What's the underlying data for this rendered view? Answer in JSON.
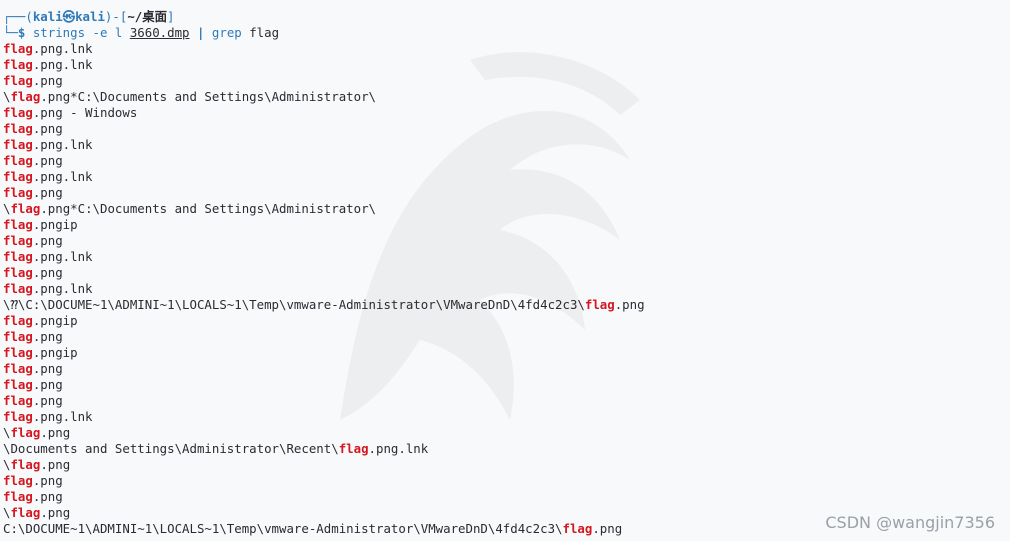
{
  "prompt": {
    "top_left": "┌──(",
    "user": "kali㉿kali",
    "mid": ")-[",
    "dir": "~/桌面",
    "close": "]",
    "bottom_left": "└─",
    "dollar": "$ ",
    "command_name": "strings",
    "command_args": " -e l ",
    "command_file": "3660.dmp",
    "pipe": " | ",
    "grep_cmd": "grep",
    "grep_arg": " flag"
  },
  "output_lines": [
    {
      "pre": "",
      "hl": "flag",
      "post": ".png.lnk"
    },
    {
      "pre": "",
      "hl": "flag",
      "post": ".png.lnk"
    },
    {
      "pre": "",
      "hl": "flag",
      "post": ".png"
    },
    {
      "pre": "\\",
      "hl": "flag",
      "post": ".png*C:\\Documents and Settings\\Administrator\\"
    },
    {
      "pre": "",
      "hl": "flag",
      "post": ".png - Windows"
    },
    {
      "pre": "",
      "hl": "flag",
      "post": ".png"
    },
    {
      "pre": "",
      "hl": "flag",
      "post": ".png.lnk"
    },
    {
      "pre": "",
      "hl": "flag",
      "post": ".png"
    },
    {
      "pre": "",
      "hl": "flag",
      "post": ".png.lnk"
    },
    {
      "pre": "",
      "hl": "flag",
      "post": ".png"
    },
    {
      "pre": "\\",
      "hl": "flag",
      "post": ".png*C:\\Documents and Settings\\Administrator\\"
    },
    {
      "pre": "",
      "hl": "flag",
      "post": ".pngip"
    },
    {
      "pre": "",
      "hl": "flag",
      "post": ".png"
    },
    {
      "pre": "",
      "hl": "flag",
      "post": ".png.lnk"
    },
    {
      "pre": "",
      "hl": "flag",
      "post": ".png"
    },
    {
      "pre": "",
      "hl": "flag",
      "post": ".png.lnk"
    },
    {
      "pre": "\\⁇\\C:\\DOCUME~1\\ADMINI~1\\LOCALS~1\\Temp\\vmware-Administrator\\VMwareDnD\\4fd4c2c3\\",
      "hl": "flag",
      "post": ".png"
    },
    {
      "pre": "",
      "hl": "flag",
      "post": ".pngip"
    },
    {
      "pre": "",
      "hl": "flag",
      "post": ".png"
    },
    {
      "pre": "",
      "hl": "flag",
      "post": ".pngip"
    },
    {
      "pre": "",
      "hl": "flag",
      "post": ".png"
    },
    {
      "pre": "",
      "hl": "flag",
      "post": ".png"
    },
    {
      "pre": "",
      "hl": "flag",
      "post": ".png"
    },
    {
      "pre": "",
      "hl": "flag",
      "post": ".png.lnk"
    },
    {
      "pre": "\\",
      "hl": "flag",
      "post": ".png"
    },
    {
      "pre": "\\Documents and Settings\\Administrator\\Recent\\",
      "hl": "flag",
      "post": ".png.lnk"
    },
    {
      "pre": "\\",
      "hl": "flag",
      "post": ".png"
    },
    {
      "pre": "",
      "hl": "flag",
      "post": ".png"
    },
    {
      "pre": "",
      "hl": "flag",
      "post": ".png"
    },
    {
      "pre": "\\",
      "hl": "flag",
      "post": ".png"
    },
    {
      "pre": "C:\\DOCUME~1\\ADMINI~1\\LOCALS~1\\Temp\\vmware-Administrator\\VMwareDnD\\4fd4c2c3\\",
      "hl": "flag",
      "post": ".png"
    }
  ],
  "watermark": "CSDN @wangjin7356",
  "colors": {
    "background": "#f8f9fb",
    "highlight": "#d4161e",
    "prompt": "#2e7ab8",
    "text": "#2b2b33"
  }
}
